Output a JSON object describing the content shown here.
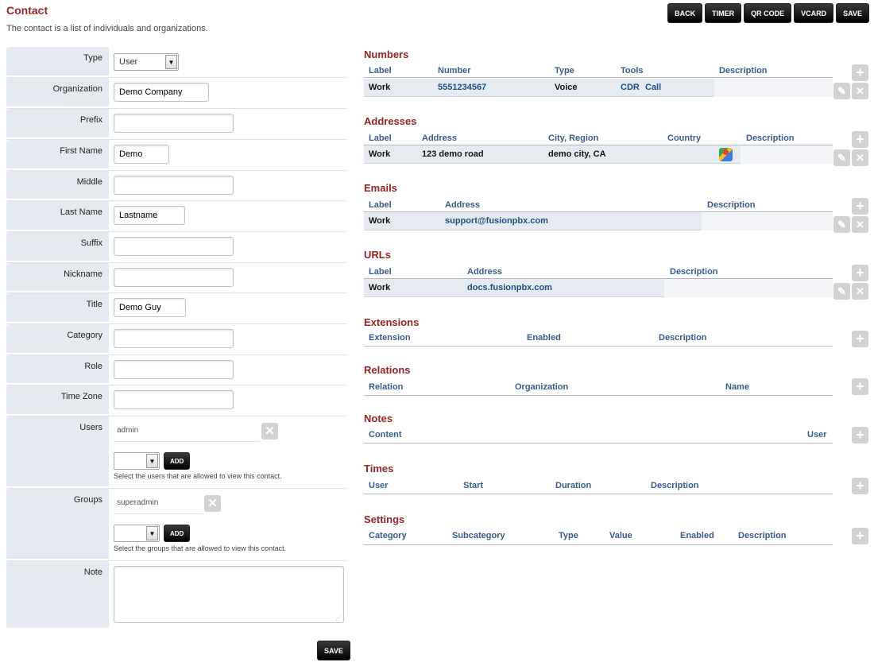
{
  "page": {
    "title": "Contact",
    "description": "The contact is a list of individuals and organizations."
  },
  "toolbar": {
    "back": "BACK",
    "timer": "TIMER",
    "qr_code": "QR CODE",
    "vcard": "VCARD",
    "save": "SAVE"
  },
  "form": {
    "type": {
      "label": "Type",
      "value": "User"
    },
    "organization": {
      "label": "Organization",
      "value": "Demo Company"
    },
    "prefix": {
      "label": "Prefix",
      "value": ""
    },
    "first_name": {
      "label": "First Name",
      "value": "Demo"
    },
    "middle": {
      "label": "Middle",
      "value": ""
    },
    "last_name": {
      "label": "Last Name",
      "value": "Lastname"
    },
    "suffix": {
      "label": "Suffix",
      "value": ""
    },
    "nickname": {
      "label": "Nickname",
      "value": ""
    },
    "title": {
      "label": "Title",
      "value": "Demo Guy"
    },
    "category": {
      "label": "Category",
      "value": ""
    },
    "role": {
      "label": "Role",
      "value": ""
    },
    "time_zone": {
      "label": "Time Zone",
      "value": ""
    },
    "users": {
      "label": "Users",
      "assigned": "admin",
      "add_label": "ADD",
      "hint": "Select the users that are allowed to view this contact."
    },
    "groups": {
      "label": "Groups",
      "assigned": "superadmin",
      "add_label": "ADD",
      "hint": "Select the groups that are allowed to view this contact."
    },
    "note": {
      "label": "Note",
      "value": ""
    },
    "save_label": "SAVE"
  },
  "numbers": {
    "title": "Numbers",
    "headers": [
      "Label",
      "Number",
      "Type",
      "Tools",
      "Description"
    ],
    "row": {
      "label": "Work",
      "number": "5551234567",
      "type": "Voice",
      "tool_cdr": "CDR",
      "tool_call": "Call",
      "description": ""
    }
  },
  "addresses": {
    "title": "Addresses",
    "headers": [
      "Label",
      "Address",
      "City, Region",
      "Country",
      "Description"
    ],
    "row": {
      "label": "Work",
      "address": "123 demo road",
      "city_region": "demo city, CA",
      "country": "",
      "description": ""
    }
  },
  "emails": {
    "title": "Emails",
    "headers": [
      "Label",
      "Address",
      "Description"
    ],
    "row": {
      "label": "Work",
      "address": "support@fusionpbx.com",
      "description": ""
    }
  },
  "urls": {
    "title": "URLs",
    "headers": [
      "Label",
      "Address",
      "Description"
    ],
    "row": {
      "label": "Work",
      "address": "docs.fusionpbx.com",
      "description": ""
    }
  },
  "extensions": {
    "title": "Extensions",
    "headers": [
      "Extension",
      "Enabled",
      "Description"
    ]
  },
  "relations": {
    "title": "Relations",
    "headers": [
      "Relation",
      "Organization",
      "Name"
    ]
  },
  "notes": {
    "title": "Notes",
    "headers": [
      "Content",
      "User"
    ]
  },
  "times": {
    "title": "Times",
    "headers": [
      "User",
      "Start",
      "Duration",
      "Description"
    ]
  },
  "settings": {
    "title": "Settings",
    "headers": [
      "Category",
      "Subcategory",
      "Type",
      "Value",
      "Enabled",
      "Description"
    ]
  },
  "icons": {
    "add": "plus-icon",
    "edit": "pencil-icon",
    "delete": "x-icon",
    "map": "google-maps-icon",
    "dropdown": "chevron-down-icon"
  }
}
